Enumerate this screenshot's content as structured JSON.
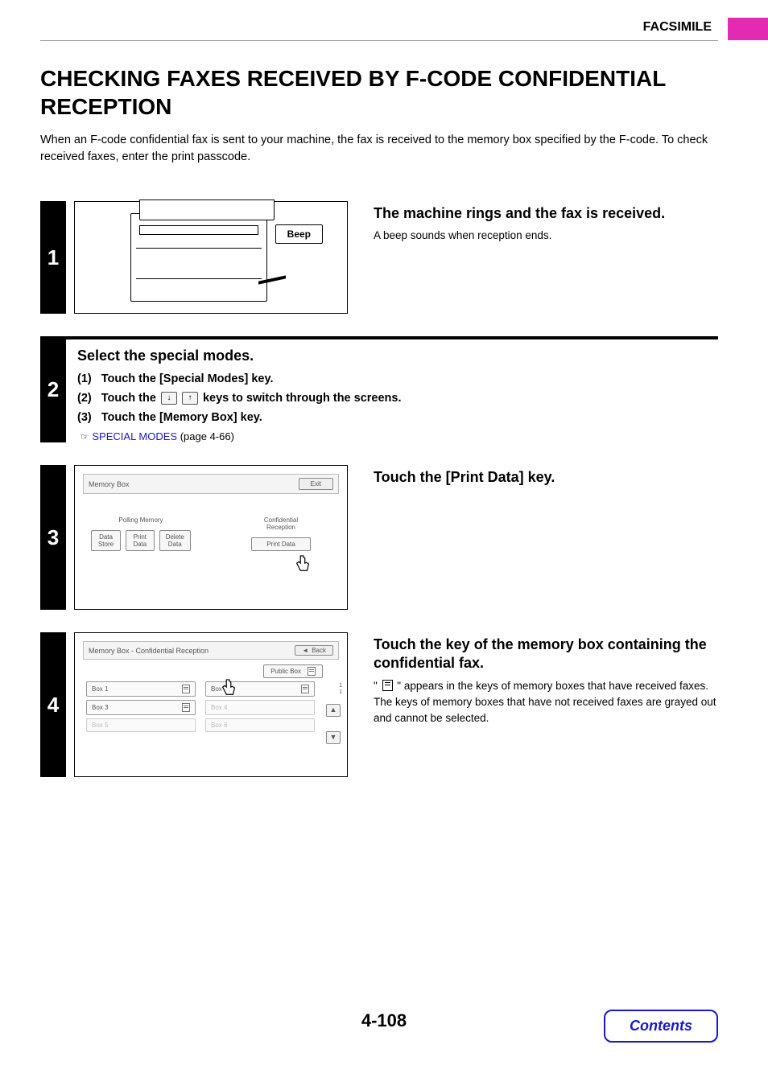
{
  "header": {
    "section": "FACSIMILE"
  },
  "title": "CHECKING FAXES RECEIVED BY F-CODE CONFIDENTIAL RECEPTION",
  "intro": "When an F-code confidential fax is sent to your machine, the fax is received to the memory box specified by the F-code. To check received faxes, enter the print passcode.",
  "step1": {
    "num": "1",
    "beep": "Beep",
    "heading": "The machine rings and the fax is received.",
    "body": "A beep sounds when reception ends."
  },
  "step2": {
    "num": "2",
    "heading": "Select the special modes.",
    "items": {
      "a_num": "(1)",
      "a": "Touch the [Special Modes] key.",
      "b_num": "(2)",
      "b_pre": "Touch the ",
      "b_post": " keys to switch through the screens.",
      "c_num": "(3)",
      "c": "Touch the [Memory Box] key."
    },
    "link": "SPECIAL MODES",
    "link_page": " (page 4-66)"
  },
  "step3": {
    "num": "3",
    "heading": "Touch the [Print Data] key.",
    "screen": {
      "title": "Memory Box",
      "exit": "Exit",
      "left_title": "Polling Memory",
      "right_title": "Confidential\nReception",
      "btn1": "Data Store",
      "btn2": "Print Data",
      "btn3": "Delete Data",
      "btn4": "Print Data"
    }
  },
  "step4": {
    "num": "4",
    "heading": "Touch the key of the memory box containing the confidential fax.",
    "body_pre": "\" ",
    "body_post": " \" appears in the keys of memory boxes that have received faxes. The keys of memory boxes that have not received faxes are grayed out and cannot be selected.",
    "screen": {
      "title": "Memory Box - Confidential Reception",
      "back": "Back",
      "public": "Public Box",
      "page_ind": "1\n1",
      "box1": "Box 1",
      "box2": "Box 2",
      "box3": "Box 3",
      "box4": "Box 4",
      "box5": "Box 5",
      "box6": "Box 6"
    }
  },
  "page_num": "4-108",
  "contents": "Contents"
}
